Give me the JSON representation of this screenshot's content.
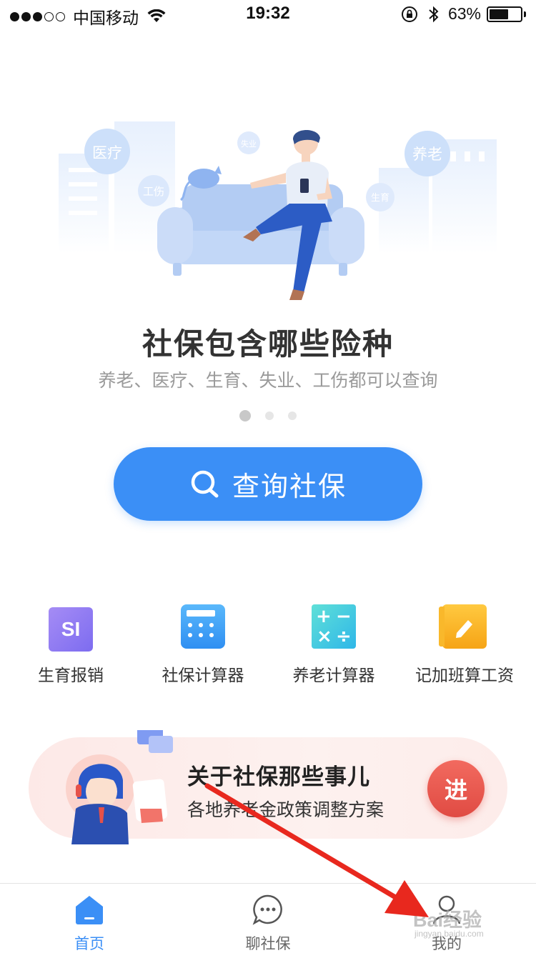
{
  "status_bar": {
    "carrier": "中国移动",
    "time": "19:32",
    "battery_text": "63%",
    "battery_level": 0.63,
    "signal_bars": 3,
    "signal_total": 5
  },
  "banner": {
    "bubbles": [
      "医疗",
      "工伤",
      "失业",
      "养老",
      "生育"
    ],
    "title": "社保包含哪些险种",
    "subtitle": "养老、医疗、生育、失业、工伤都可以查询",
    "page_count": 3,
    "active_page": 0
  },
  "query_button": {
    "label": "查询社保",
    "icon": "search-icon"
  },
  "tools": [
    {
      "label": "生育报销",
      "icon": "si-icon",
      "icon_text": "SI"
    },
    {
      "label": "社保计算器",
      "icon": "calculator-icon"
    },
    {
      "label": "养老计算器",
      "icon": "math-symbols-icon"
    },
    {
      "label": "记加班算工资",
      "icon": "notebook-pencil-icon"
    }
  ],
  "promo": {
    "title": "关于社保那些事儿",
    "subtitle": "各地养老金政策调整方案",
    "button_label": "进"
  },
  "tabbar": {
    "tabs": [
      {
        "label": "首页",
        "icon": "home-icon",
        "active": true
      },
      {
        "label": "聊社保",
        "icon": "chat-bubble-icon",
        "active": false
      },
      {
        "label": "我的",
        "icon": "user-icon",
        "active": false
      }
    ]
  },
  "watermark": {
    "text": "Bai经验",
    "sub": "jingyan.baidu.com"
  },
  "colors": {
    "primary": "#3b8ff6",
    "promo_red": "#e04b43",
    "annotation_red": "#e8281e"
  }
}
